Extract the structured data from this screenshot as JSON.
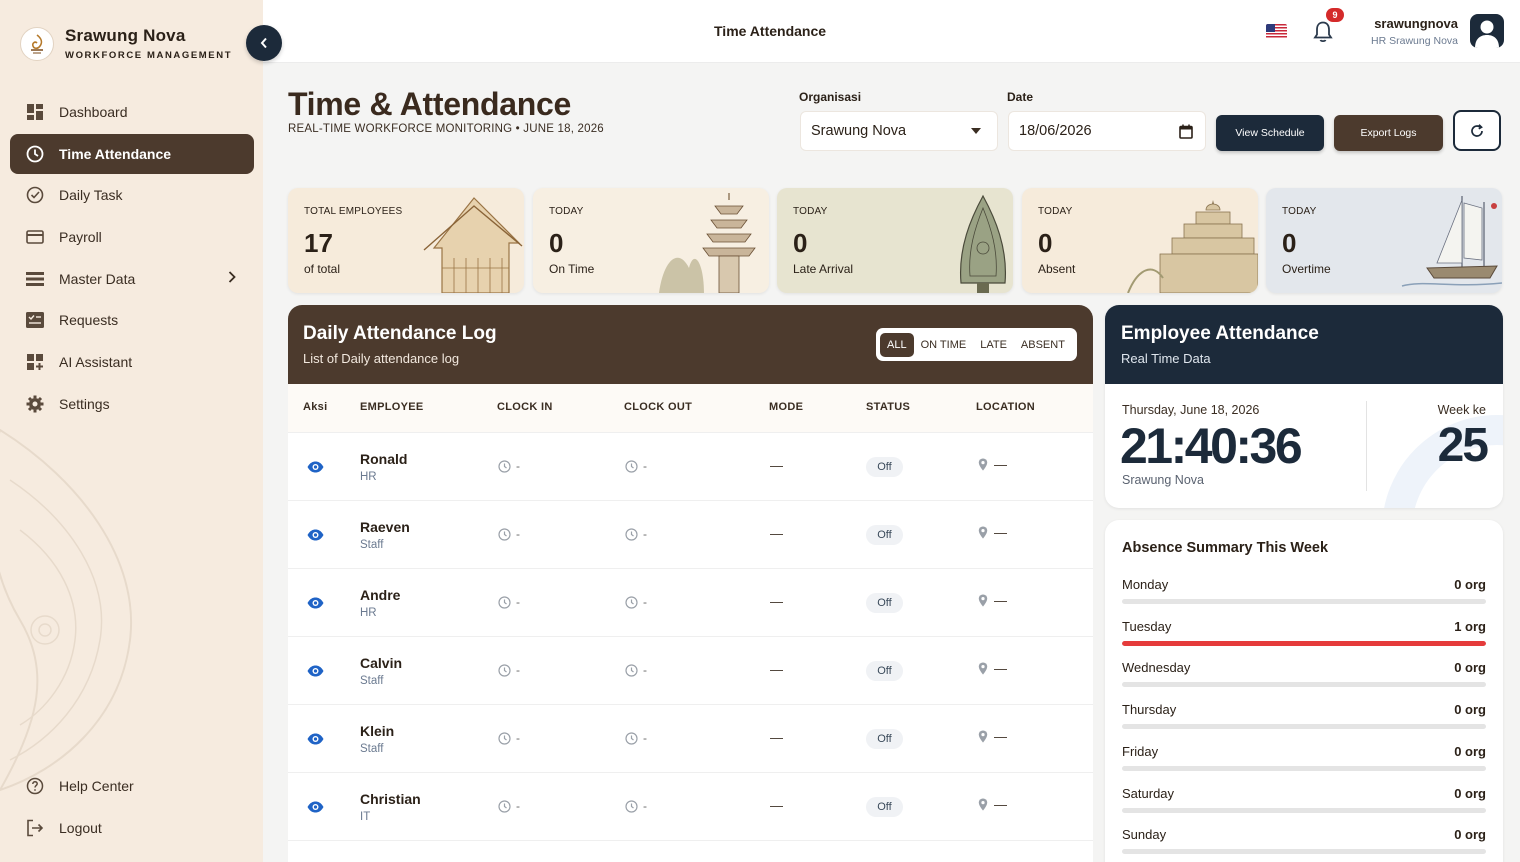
{
  "brand": {
    "name": "Srawung Nova",
    "subtitle": "WORKFORCE MANAGEMENT"
  },
  "sidebar": {
    "items": [
      {
        "label": "Dashboard",
        "icon": "dashboard-icon"
      },
      {
        "label": "Time Attendance",
        "icon": "clock-icon",
        "active": true
      },
      {
        "label": "Daily Task",
        "icon": "check-circle-icon"
      },
      {
        "label": "Payroll",
        "icon": "card-icon"
      },
      {
        "label": "Master Data",
        "icon": "list-icon"
      },
      {
        "label": "Requests",
        "icon": "request-icon"
      },
      {
        "label": "AI Assistant",
        "icon": "grid-plus-icon"
      },
      {
        "label": "Settings",
        "icon": "gear-icon"
      }
    ],
    "bottom": [
      {
        "label": "Help Center",
        "icon": "help-icon"
      },
      {
        "label": "Logout",
        "icon": "logout-icon"
      }
    ]
  },
  "header": {
    "title": "Time Attendance",
    "notifications": "9",
    "user": {
      "name": "srawungnova",
      "role": "HR Srawung Nova"
    }
  },
  "page": {
    "title": "Time & Attendance",
    "subtitle": "REAL-TIME WORKFORCE MONITORING • JUNE 18, 2026",
    "org_label": "Organisasi",
    "org_value": "Srawung Nova",
    "date_label": "Date",
    "date_value": "18/06/2026",
    "view_schedule": "View Schedule",
    "export_logs": "Export Logs"
  },
  "stats": [
    {
      "label": "TOTAL EMPLOYEES",
      "value": "17",
      "sub": "of total"
    },
    {
      "label": "TODAY",
      "value": "0",
      "sub": "On Time"
    },
    {
      "label": "TODAY",
      "value": "0",
      "sub": "Late Arrival"
    },
    {
      "label": "TODAY",
      "value": "0",
      "sub": "Absent"
    },
    {
      "label": "TODAY",
      "value": "0",
      "sub": "Overtime"
    }
  ],
  "log": {
    "title": "Daily Attendance Log",
    "subtitle": "List of Daily attendance log",
    "filters": [
      "ALL",
      "ON TIME",
      "LATE",
      "ABSENT"
    ],
    "columns": [
      "Aksi",
      "EMPLOYEE",
      "CLOCK IN",
      "CLOCK OUT",
      "MODE",
      "STATUS",
      "LOCATION"
    ],
    "rows": [
      {
        "name": "Ronald",
        "dept": "HR",
        "clock_in": "-",
        "clock_out": "-",
        "mode": "—",
        "status": "Off",
        "location": "—"
      },
      {
        "name": "Raeven",
        "dept": "Staff",
        "clock_in": "-",
        "clock_out": "-",
        "mode": "—",
        "status": "Off",
        "location": "—"
      },
      {
        "name": "Andre",
        "dept": "HR",
        "clock_in": "-",
        "clock_out": "-",
        "mode": "—",
        "status": "Off",
        "location": "—"
      },
      {
        "name": "Calvin",
        "dept": "Staff",
        "clock_in": "-",
        "clock_out": "-",
        "mode": "—",
        "status": "Off",
        "location": "—"
      },
      {
        "name": "Klein",
        "dept": "Staff",
        "clock_in": "-",
        "clock_out": "-",
        "mode": "—",
        "status": "Off",
        "location": "—"
      },
      {
        "name": "Christian",
        "dept": "IT",
        "clock_in": "-",
        "clock_out": "-",
        "mode": "—",
        "status": "Off",
        "location": "—"
      }
    ]
  },
  "employee_attendance": {
    "title": "Employee Attendance",
    "subtitle": "Real Time Data",
    "date": "Thursday, June 18, 2026",
    "time": "21:40:36",
    "org": "Srawung Nova",
    "week_label": "Week ke",
    "week_value": "25"
  },
  "absence": {
    "title": "Absence Summary This Week",
    "days": [
      {
        "day": "Monday",
        "value": "0 org",
        "fraction": 0
      },
      {
        "day": "Tuesday",
        "value": "1 org",
        "fraction": 1
      },
      {
        "day": "Wednesday",
        "value": "0 org",
        "fraction": 0
      },
      {
        "day": "Thursday",
        "value": "0 org",
        "fraction": 0
      },
      {
        "day": "Friday",
        "value": "0 org",
        "fraction": 0
      },
      {
        "day": "Saturday",
        "value": "0 org",
        "fraction": 0
      },
      {
        "day": "Sunday",
        "value": "0 org",
        "fraction": 0
      }
    ]
  },
  "colors": {
    "brown": "#4c3a2d",
    "navy": "#1c2a3a",
    "accent_red": "#e53b3b",
    "sidebar_bg": "#f6ebdf"
  }
}
